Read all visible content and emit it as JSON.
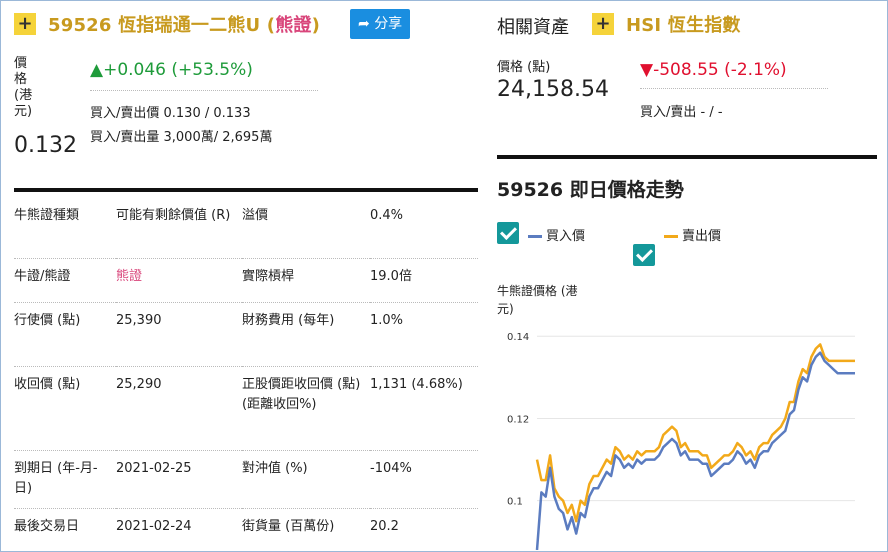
{
  "product": {
    "title_prefix": "59526 恆指瑞通一二熊U (",
    "type_word": "熊證",
    "title_suffix": ")",
    "share_label": "分享",
    "price_label": "價格(港元)",
    "price": "0.132",
    "change": "+0.046 (+53.5%)",
    "bid_ask_price": "買入/賣出價 0.130 / 0.133",
    "bid_ask_volume": "買入/賣出量 3,000萬/ 2,695萬"
  },
  "related": {
    "heading": "相關資產",
    "name": "HSI 恆生指數",
    "price_label": "價格 (點)",
    "price": "24,158.54",
    "change": "-508.55 (-2.1%)",
    "bid_ask": "買入/賣出 - / -"
  },
  "info_rows": [
    {
      "l1": "牛熊證種類",
      "v1": "可能有剩餘價值 (R)",
      "l2": "溢價",
      "v2": "0.4%"
    },
    {
      "l1": "牛證/熊證",
      "v1": "熊證",
      "l2": "實際槓桿",
      "v2": "19.0倍"
    },
    {
      "l1": "行使價 (點)",
      "v1": "25,390",
      "l2": "財務費用 (每年)",
      "v2": "1.0%"
    },
    {
      "l1": "收回價 (點)",
      "v1": "25,290",
      "l2": "正股價距收回價 (點) (距離收回%)",
      "v2": "1,131 (4.68%)"
    },
    {
      "l1": "到期日 (年-月-日)",
      "v1": "2021-02-25",
      "l2": "對沖值 (%)",
      "v2": "-104%"
    },
    {
      "l1": "最後交易日",
      "v1": "2021-02-24",
      "l2": "街貨量 (百萬份)",
      "v2": "20.2"
    }
  ],
  "chart_section": {
    "title": "59526 即日價格走勢",
    "legend_bid": "買入價",
    "legend_ask": "賣出價"
  },
  "chart_data": {
    "type": "line",
    "ylabel": "牛熊證價格 (港元)",
    "yticks": [
      "0.14",
      "0.12",
      "0.1"
    ],
    "ylim": [
      0.088,
      0.142
    ],
    "series": [
      {
        "name": "買入價",
        "color": "#5b7cc0",
        "values": [
          0.088,
          0.102,
          0.101,
          0.108,
          0.101,
          0.098,
          0.097,
          0.093,
          0.096,
          0.092,
          0.097,
          0.096,
          0.101,
          0.103,
          0.103,
          0.105,
          0.107,
          0.106,
          0.111,
          0.11,
          0.108,
          0.109,
          0.108,
          0.11,
          0.109,
          0.11,
          0.11,
          0.11,
          0.111,
          0.113,
          0.114,
          0.115,
          0.114,
          0.111,
          0.112,
          0.11,
          0.11,
          0.11,
          0.109,
          0.109,
          0.106,
          0.107,
          0.108,
          0.109,
          0.109,
          0.11,
          0.112,
          0.111,
          0.109,
          0.11,
          0.108,
          0.111,
          0.112,
          0.112,
          0.114,
          0.115,
          0.116,
          0.117,
          0.121,
          0.122,
          0.127,
          0.13,
          0.129,
          0.133,
          0.135,
          0.136,
          0.134,
          0.133,
          0.132,
          0.131,
          0.131,
          0.131,
          0.131,
          0.131
        ]
      },
      {
        "name": "賣出價",
        "color": "#f2a91a",
        "values": [
          0.11,
          0.105,
          0.105,
          0.111,
          0.103,
          0.101,
          0.1,
          0.097,
          0.099,
          0.095,
          0.1,
          0.099,
          0.104,
          0.106,
          0.106,
          0.108,
          0.11,
          0.109,
          0.113,
          0.112,
          0.11,
          0.111,
          0.11,
          0.112,
          0.111,
          0.112,
          0.112,
          0.112,
          0.113,
          0.116,
          0.117,
          0.118,
          0.117,
          0.113,
          0.114,
          0.112,
          0.112,
          0.112,
          0.111,
          0.111,
          0.108,
          0.109,
          0.11,
          0.111,
          0.111,
          0.112,
          0.114,
          0.113,
          0.111,
          0.112,
          0.11,
          0.113,
          0.114,
          0.114,
          0.116,
          0.117,
          0.118,
          0.12,
          0.124,
          0.124,
          0.129,
          0.132,
          0.131,
          0.135,
          0.137,
          0.138,
          0.135,
          0.134,
          0.134,
          0.134,
          0.134,
          0.134,
          0.134,
          0.134
        ]
      }
    ]
  }
}
